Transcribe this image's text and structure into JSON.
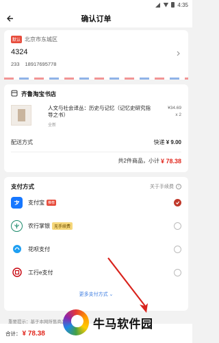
{
  "status_bar": {
    "time": "4:35"
  },
  "header": {
    "title": "确认订单"
  },
  "address": {
    "default_tag": "默认",
    "region": "北京市东城区",
    "detail": "4324",
    "name": "233",
    "phone": "18917695778"
  },
  "shop": {
    "name": "齐鲁淘宝书店",
    "product": {
      "title": "人文与社会译丛：历史与记忆（记忆史研究指导之书）",
      "condition": "全新",
      "price": "¥34.69",
      "quantity": "x 2"
    },
    "shipping_label": "配送方式",
    "shipping_value": "快递",
    "shipping_fee": "¥ 9.00",
    "count_text": "共2件商品，小计",
    "subtotal": "¥ 78.38"
  },
  "payment": {
    "title": "支付方式",
    "fee_link": "关于手续费",
    "methods": [
      {
        "label": "支付宝",
        "tag": "推荐",
        "selected": true
      },
      {
        "label": "农行掌银",
        "tag": "无手续费",
        "selected": false
      },
      {
        "label": "花呗支付",
        "tag": "",
        "selected": false
      },
      {
        "label": "工行e支付",
        "tag": "",
        "selected": false
      }
    ],
    "more": "更多支付方式"
  },
  "notice": "重要提示：基于本网所售商品为有收藏价值...",
  "bottom": {
    "total_label": "合计：",
    "total_amount": "¥ 78.38"
  },
  "watermark": {
    "text": "牛马软件园"
  },
  "colors": {
    "accent": "#e1251b",
    "link": "#3a7be0",
    "stripe_red": "#f29595",
    "stripe_blue": "#8fb3e8"
  }
}
